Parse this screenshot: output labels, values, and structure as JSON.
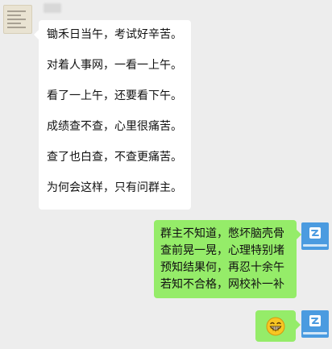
{
  "incoming": {
    "lines": [
      "锄禾日当午，考试好辛苦。",
      "对着人事网，一看一上午。",
      "看了一上午，还要看下午。",
      "成绩查不查，心里很痛苦。",
      "查了也白查，不查更痛苦。",
      "为何会这样，只有问群主。"
    ]
  },
  "outgoing": {
    "message_1_lines": [
      "群主不知道，憋坏脑壳骨",
      "查前晃一晃，心理特别堵",
      "预知结果何，再忍十余午",
      "若知不合格，网校补一补"
    ],
    "message_2_emoji": "grinning-face-emoji"
  },
  "colors": {
    "chat_background": "#ededed",
    "incoming_bubble": "#ffffff",
    "outgoing_bubble": "#95ec69",
    "self_avatar": "#4b9be0"
  }
}
